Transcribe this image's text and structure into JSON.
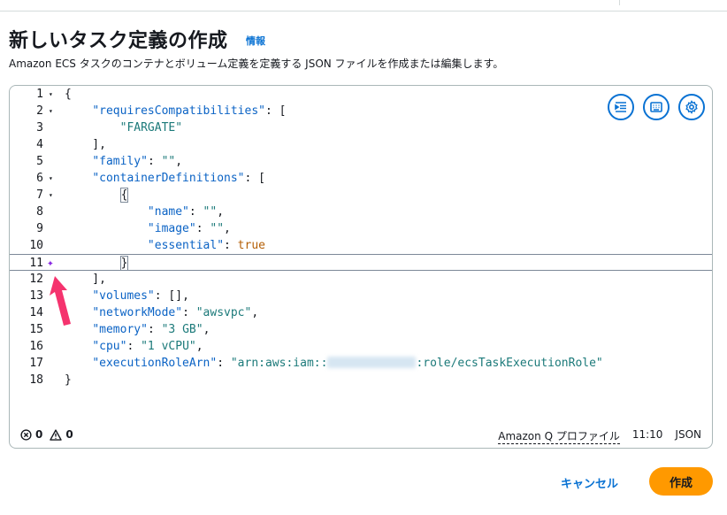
{
  "header": {
    "title": "新しいタスク定義の作成",
    "info_link": "情報",
    "subtitle": "Amazon ECS タスクのコンテナとボリューム定義を定義する JSON ファイルを作成または編集します。"
  },
  "editor": {
    "lines": [
      {
        "n": "1",
        "html": "{"
      },
      {
        "n": "2",
        "html": "    <span class=\"k\">\"requiresCompatibilities\"</span>: ["
      },
      {
        "n": "3",
        "html": "        <span class=\"s\">\"FARGATE\"</span>"
      },
      {
        "n": "4",
        "html": "    ],"
      },
      {
        "n": "5",
        "html": "    <span class=\"k\">\"family\"</span>: <span class=\"s\">\"\"</span>,"
      },
      {
        "n": "6",
        "html": "    <span class=\"k\">\"containerDefinitions\"</span>: ["
      },
      {
        "n": "7",
        "html": "        <span class=\"bracket-box\">{</span>"
      },
      {
        "n": "8",
        "html": "            <span class=\"k\">\"name\"</span>: <span class=\"s\">\"\"</span>,"
      },
      {
        "n": "9",
        "html": "            <span class=\"k\">\"image\"</span>: <span class=\"s\">\"\"</span>,"
      },
      {
        "n": "10",
        "html": "            <span class=\"k\">\"essential\"</span>: <span class=\"b\">true</span>"
      },
      {
        "n": "11",
        "html": "        <span class=\"bracket-box\">}</span>"
      },
      {
        "n": "12",
        "html": "    ],"
      },
      {
        "n": "13",
        "html": "    <span class=\"k\">\"volumes\"</span>: [],"
      },
      {
        "n": "14",
        "html": "    <span class=\"k\">\"networkMode\"</span>: <span class=\"s\">\"awsvpc\"</span>,"
      },
      {
        "n": "15",
        "html": "    <span class=\"k\">\"memory\"</span>: <span class=\"s\">\"3 GB\"</span>,"
      },
      {
        "n": "16",
        "html": "    <span class=\"k\">\"cpu\"</span>: <span class=\"s\">\"1 vCPU\"</span>,"
      },
      {
        "n": "17",
        "html": "    <span class=\"k\">\"executionRoleArn\"</span>: <span class=\"s\">\"arn:aws:iam::<span class=\"blur\"></span>:role/ecsTaskExecutionRole\"</span>"
      },
      {
        "n": "18",
        "html": "}"
      }
    ],
    "fold_lines": [
      1,
      2,
      6,
      7
    ],
    "active_line": 11,
    "toolbar": {
      "icons": [
        "indent-icon",
        "keyboard-icon",
        "settings-icon"
      ]
    },
    "status": {
      "errors": "0",
      "warnings": "0",
      "profile": "Amazon Q プロファイル",
      "position": "11:10",
      "language": "JSON"
    }
  },
  "footer": {
    "cancel_label": "キャンセル",
    "create_label": "作成"
  },
  "colors": {
    "accent": "#0972d3",
    "primary_button": "#ff9900",
    "arrow": "#f5336e"
  }
}
